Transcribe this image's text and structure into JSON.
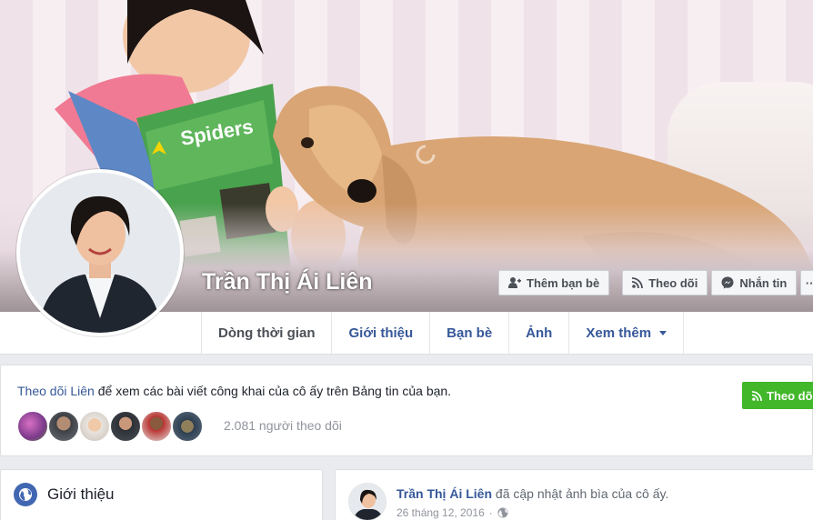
{
  "profile": {
    "name": "Trần Thị Ái Liên"
  },
  "cover_buttons": {
    "add_friend": "Thêm bạn bè",
    "follow": "Theo dõi",
    "message": "Nhắn tin"
  },
  "tabs": [
    {
      "label": "Dòng thời gian",
      "active": true
    },
    {
      "label": "Giới thiệu"
    },
    {
      "label": "Bạn bè"
    },
    {
      "label": "Ảnh"
    },
    {
      "label": "Xem thêm"
    }
  ],
  "follow_card": {
    "link": "Theo dõi Liên",
    "text": " để xem các bài viết công khai của cô ấy trên Bảng tin của bạn.",
    "follower_count": "2.081 người theo dõi",
    "button": "Theo dõi"
  },
  "intro": {
    "title": "Giới thiệu"
  },
  "post": {
    "author": "Trần Thị Ái Liên",
    "action": " đã cập nhật ảnh bìa của cô ấy.",
    "date": "26 tháng 12, 2016",
    "separator": "·"
  },
  "colors": {
    "link": "#365899",
    "follow_green": "#42b72a",
    "background": "#e9ebee"
  }
}
